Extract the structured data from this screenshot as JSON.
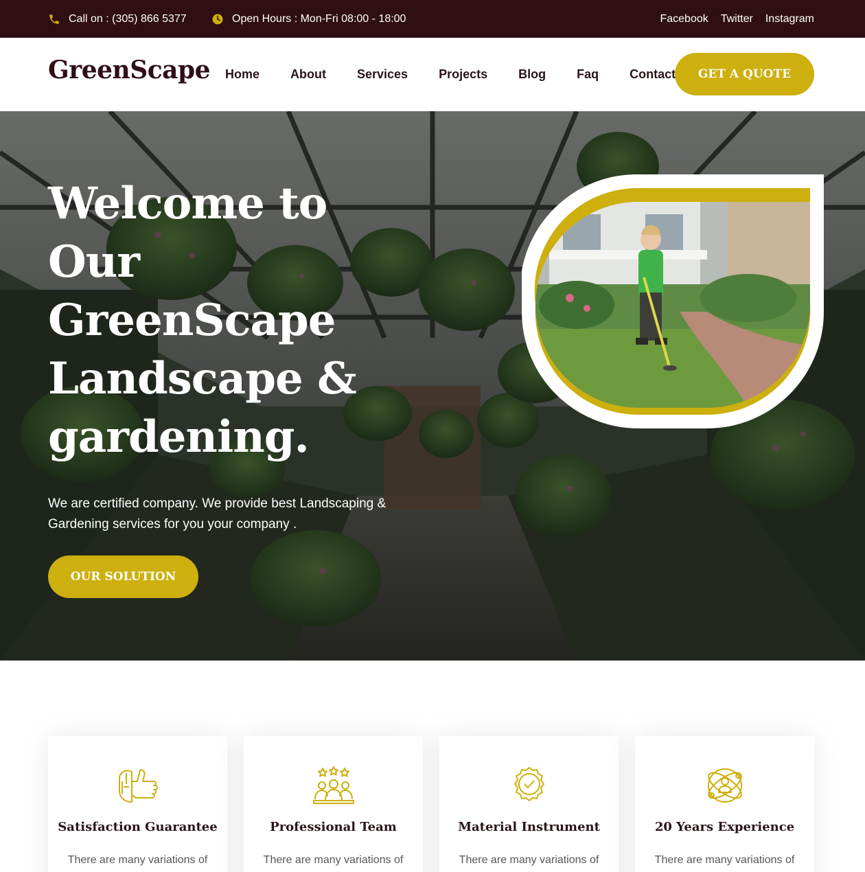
{
  "topbar": {
    "phone": "Call on : (305) 866 5377",
    "hours": "Open Hours : Mon-Fri 08:00 - 18:00",
    "social": [
      "Facebook",
      "Twitter",
      "Instagram"
    ]
  },
  "nav": {
    "logo": "GreenScape",
    "items": [
      "Home",
      "About",
      "Services",
      "Projects",
      "Blog",
      "Faq",
      "Contact"
    ],
    "cta": "GET A QUOTE"
  },
  "hero": {
    "title_lines": [
      "Welcome to",
      "Our",
      "GreenScape",
      "Landscape &",
      "gardening."
    ],
    "text_lines": [
      "We are certified company. We provide best Landscaping &",
      "Gardening services for you your company ."
    ],
    "button": "OUR SOLUTION"
  },
  "features": [
    {
      "title": "Satisfaction Guarantee",
      "text": "There are many variations of",
      "icon": "thumbs-up-icon"
    },
    {
      "title": "Professional Team",
      "text": "There are many variations of",
      "icon": "team-stars-icon"
    },
    {
      "title": "Material Instrument",
      "text": "There are many variations of",
      "icon": "quality-badge-icon"
    },
    {
      "title": "20 Years Experience",
      "text": "There are many variations of",
      "icon": "experience-orbit-icon"
    }
  ],
  "colors": {
    "accent": "#cdaf0e",
    "topbar_bg": "#2f0f13",
    "heading": "#2a1418"
  }
}
